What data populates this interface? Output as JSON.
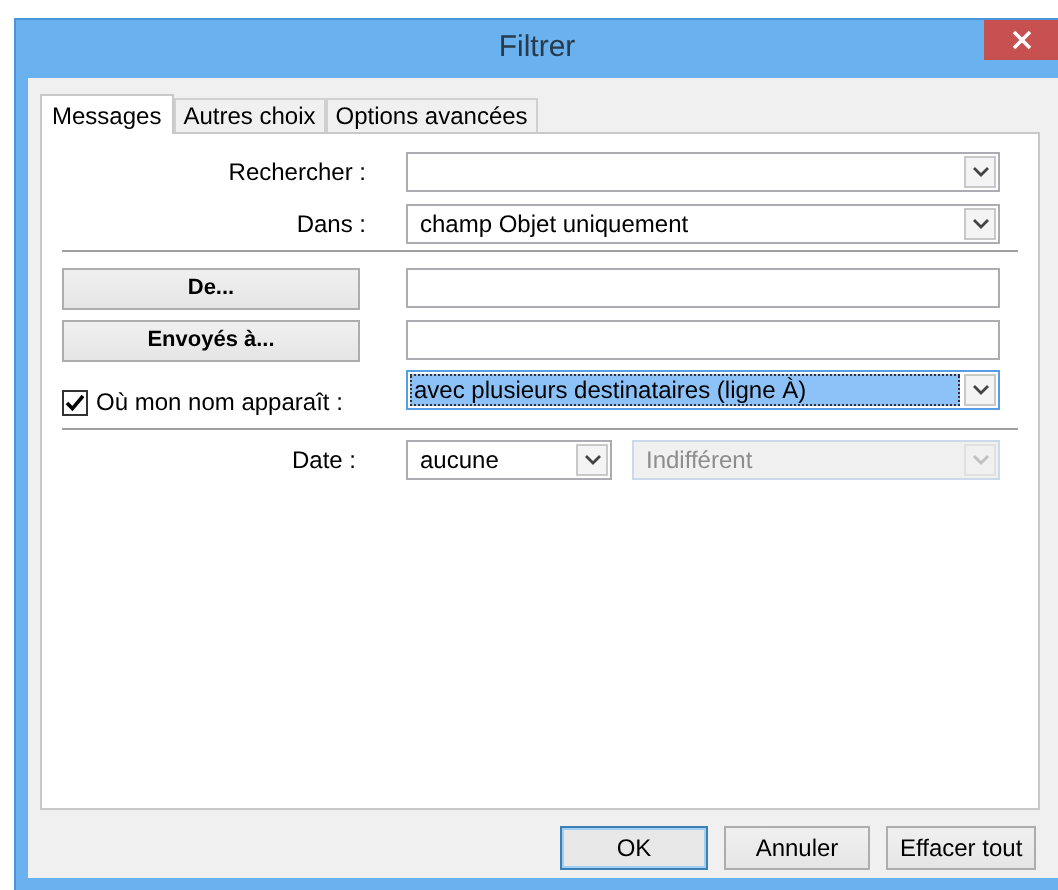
{
  "window": {
    "title": "Filtrer"
  },
  "tabs": [
    {
      "label": "Messages",
      "selected": true
    },
    {
      "label": "Autres choix",
      "selected": false
    },
    {
      "label": "Options avancées",
      "selected": false
    }
  ],
  "search": {
    "label": "Rechercher :"
  },
  "search_in": {
    "label": "Dans :",
    "value": "champ Objet uniquement"
  },
  "people": [
    {
      "button": "De..."
    },
    {
      "button": "Envoyés à..."
    }
  ],
  "where_my_name": {
    "label": "Où mon nom apparaît :",
    "checked": true,
    "value": "avec plusieurs destinataires (ligne À)",
    "focused": true
  },
  "date": {
    "label": "Date :",
    "value": "aucune",
    "range": {
      "value": "Indifférent",
      "disabled": true
    }
  },
  "buttons": [
    {
      "label": "OK",
      "default": true
    },
    {
      "label": "Annuler",
      "default": false
    },
    {
      "label": "Effacer tout",
      "default": false
    }
  ]
}
